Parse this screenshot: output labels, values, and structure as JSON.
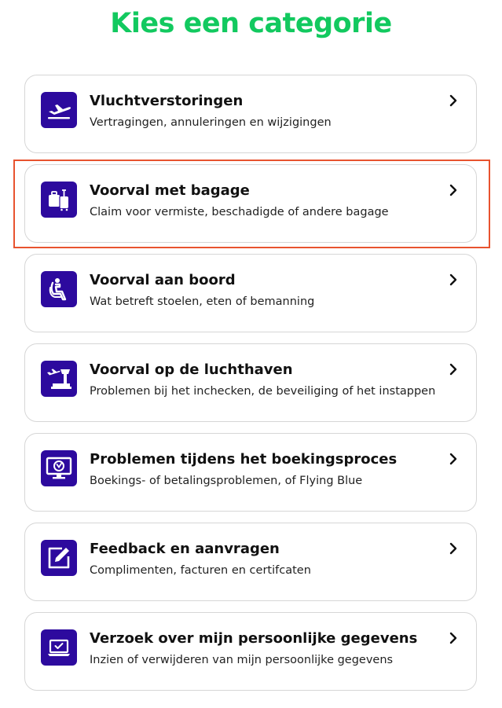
{
  "page": {
    "title": "Kies een categorie"
  },
  "colors": {
    "title": "#12c95f",
    "icon_background": "#2d0a9e",
    "highlight_border": "#e8532f"
  },
  "categories": [
    {
      "title": "Vluchtverstoringen",
      "subtitle": "Vertragingen, annuleringen en wijzigingen",
      "icon": "airplane-departure-icon"
    },
    {
      "title": "Voorval met bagage",
      "subtitle": "Claim voor vermiste, beschadigde of andere bagage",
      "icon": "luggage-icon",
      "highlighted": true
    },
    {
      "title": "Voorval aan boord",
      "subtitle": "Wat betreft stoelen, eten of bemanning",
      "icon": "passenger-seat-icon"
    },
    {
      "title": "Voorval op de luchthaven",
      "subtitle": "Problemen bij het inchecken, de beveiliging of het instappen",
      "icon": "airport-tower-icon"
    },
    {
      "title": "Problemen tijdens het boekingsproces",
      "subtitle": "Boekings- of betalingsproblemen, of Flying Blue",
      "icon": "monitor-booking-icon"
    },
    {
      "title": "Feedback en aanvragen",
      "subtitle": "Complimenten, facturen en certifcaten",
      "icon": "edit-form-icon"
    },
    {
      "title": "Verzoek over mijn persoonlijke gegevens",
      "subtitle": "Inzien of verwijderen van mijn persoonlijke gegevens",
      "icon": "laptop-personal-data-icon"
    }
  ]
}
